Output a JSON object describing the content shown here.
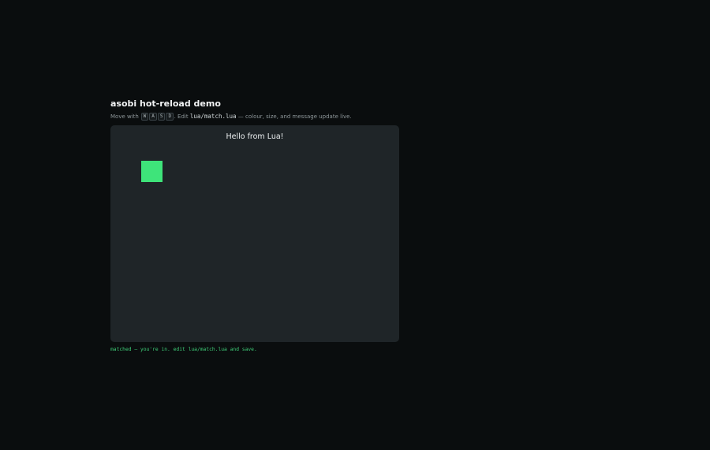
{
  "header": {
    "title": "asobi hot-reload demo",
    "subtitle": {
      "prefix": "Move with",
      "keys": [
        "W",
        "A",
        "S",
        "D"
      ],
      "middle": ". Edit",
      "file": "lua/match.lua",
      "suffix": "— colour, size, and message update live."
    }
  },
  "game": {
    "message": "Hello from Lua!",
    "player_color": "#3ee47a"
  },
  "status": {
    "text": "matched — you're in. edit lua/match.lua and save."
  },
  "colors": {
    "background": "#0a0d0e",
    "canvas": "#1f2528",
    "accent": "#3fcf79"
  }
}
